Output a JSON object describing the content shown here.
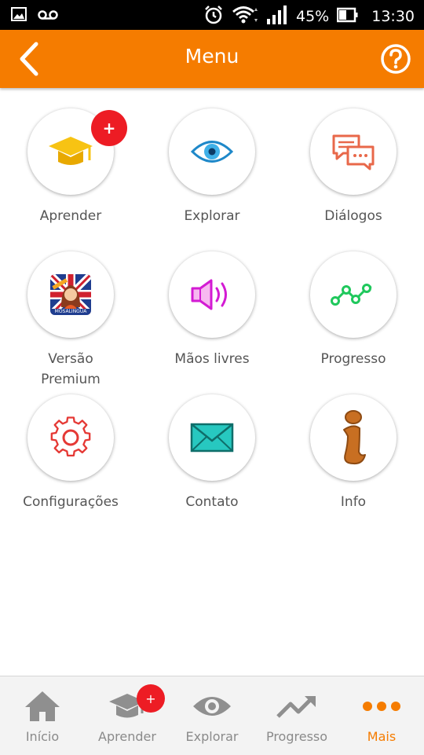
{
  "status_bar": {
    "battery": "45%",
    "time": "13:30"
  },
  "header": {
    "title": "Menu"
  },
  "menu": {
    "aprender": {
      "label": "Aprender",
      "badge": "+"
    },
    "explorar": {
      "label": "Explorar"
    },
    "dialogos": {
      "label": "Diálogos"
    },
    "versao_premium": {
      "label_line1": "Versão",
      "label_line2": "Premium",
      "icon_text": "MOSALINGUA"
    },
    "maos_livres": {
      "label": "Mãos livres"
    },
    "progresso": {
      "label": "Progresso"
    },
    "configuracoes": {
      "label": "Configurações"
    },
    "contato": {
      "label": "Contato"
    },
    "info": {
      "label": "Info"
    }
  },
  "bottom_nav": {
    "inicio": {
      "label": "Início"
    },
    "aprender": {
      "label": "Aprender",
      "badge": "+"
    },
    "explorar": {
      "label": "Explorar"
    },
    "progresso": {
      "label": "Progresso"
    },
    "mais": {
      "label": "Mais",
      "active": true
    }
  },
  "colors": {
    "accent": "#f57c00",
    "badge": "#ed1c24",
    "nav_inactive": "#8a8a8a"
  }
}
